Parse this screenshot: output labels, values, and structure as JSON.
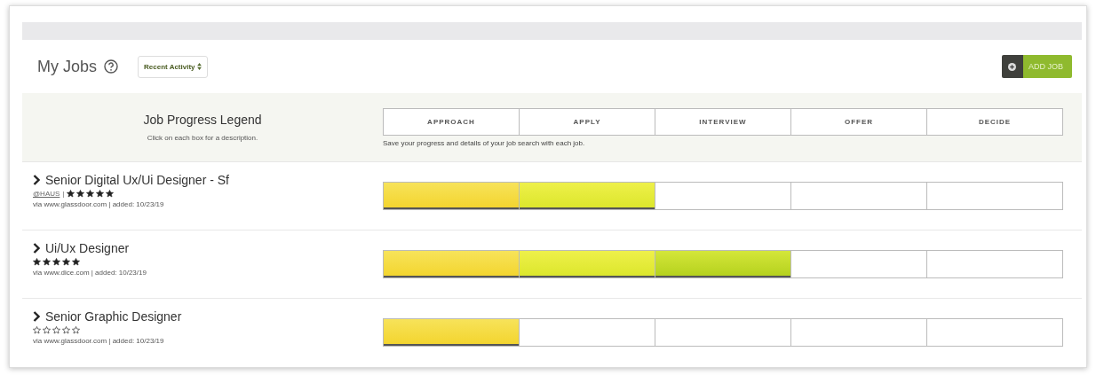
{
  "header": {
    "title": "My Jobs",
    "sort": "Recent Activity",
    "add_button": "ADD JOB"
  },
  "legend": {
    "title": "Job Progress Legend",
    "hint": "Click on each box for a description.",
    "stages": [
      "APPROACH",
      "APPLY",
      "INTERVIEW",
      "OFFER",
      "DECIDE"
    ],
    "note": "Save your progress and details of your job search with each job."
  },
  "jobs": [
    {
      "title": "Senior Digital Ux/Ui Designer - Sf",
      "company": "@HAUS",
      "separator": "|",
      "stars": 5,
      "source": "via www.glassdoor.com | added: 10/23/19",
      "stages": [
        {
          "done": true
        },
        {
          "done": true
        },
        {
          "done": false
        },
        {
          "done": false
        },
        {
          "done": false
        }
      ]
    },
    {
      "title": "Ui/Ux Designer",
      "stars": 5,
      "source": "via www.dice.com | added: 10/23/19",
      "stages": [
        {
          "done": true
        },
        {
          "done": true
        },
        {
          "done": true
        },
        {
          "done": false
        },
        {
          "done": false
        }
      ]
    },
    {
      "title": "Senior Graphic Designer",
      "stars": 0,
      "source": "via www.glassdoor.com | added: 10/23/19",
      "stages": [
        {
          "done": true
        },
        {
          "done": false
        },
        {
          "done": false
        },
        {
          "done": false
        },
        {
          "done": false
        }
      ]
    }
  ]
}
